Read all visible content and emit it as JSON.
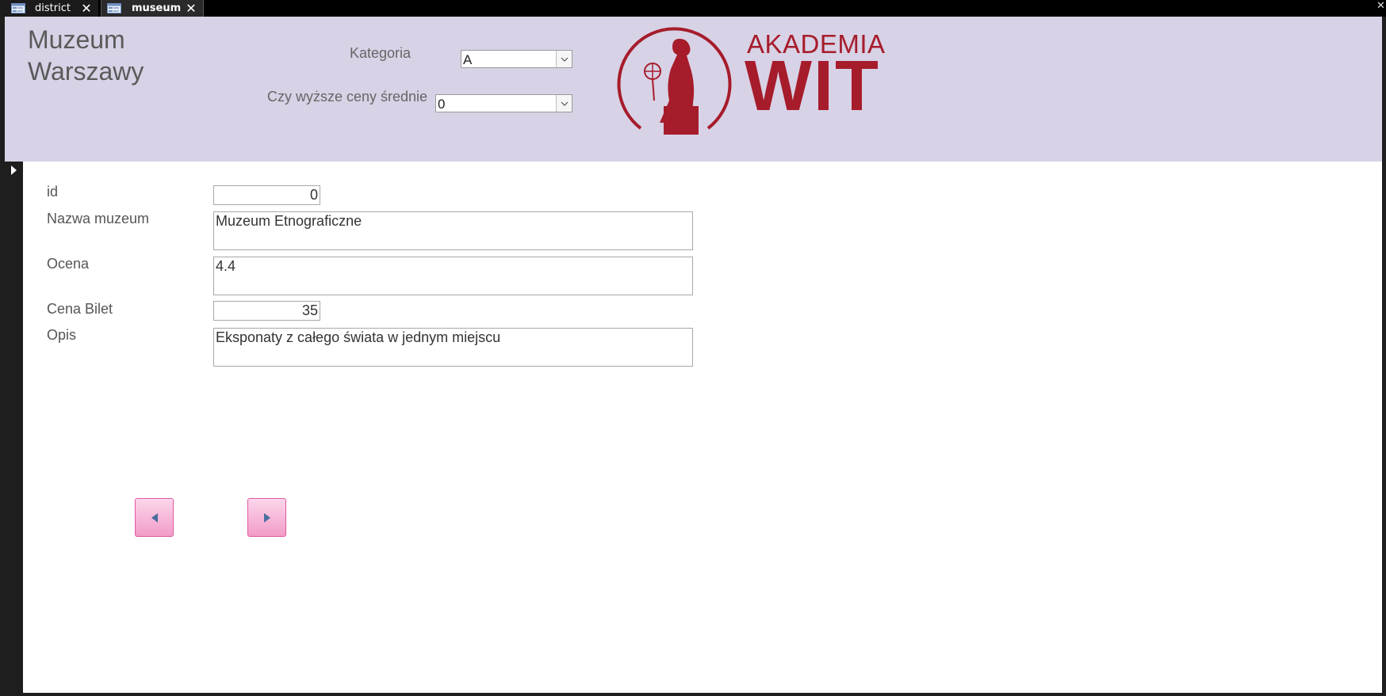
{
  "tabs": [
    {
      "label": "district",
      "icon": "form-icon",
      "close": "✕"
    },
    {
      "label": "museum",
      "icon": "form-icon",
      "close": "✕"
    }
  ],
  "window": {
    "close": "✕"
  },
  "header": {
    "title": "Muzeum\nWarszawy",
    "kategoria_label": "Kategoria",
    "kategoria_value": "A",
    "ceny_label": "Czy wyższe ceny średnie",
    "ceny_value": "0",
    "logo_word1": "AKADEMIA",
    "logo_word2": "WIT"
  },
  "colors": {
    "header_bg": "#d8d2e6",
    "logo_red": "#a61c2b",
    "button_pink": "#f29cc8"
  },
  "fields": {
    "id_label": "id",
    "id_value": "0",
    "nazwa_label": "Nazwa muzeum",
    "nazwa_value": "Muzeum Etnograficzne",
    "ocena_label": "Ocena",
    "ocena_value": "4.4",
    "cena_label": "Cena Bilet",
    "cena_value": "35",
    "opis_label": "Opis",
    "opis_value": "Eksponaty z całego świata w jednym miejscu"
  },
  "nav": {
    "prev_icon": "triangle-left-icon",
    "next_icon": "triangle-right-icon"
  }
}
